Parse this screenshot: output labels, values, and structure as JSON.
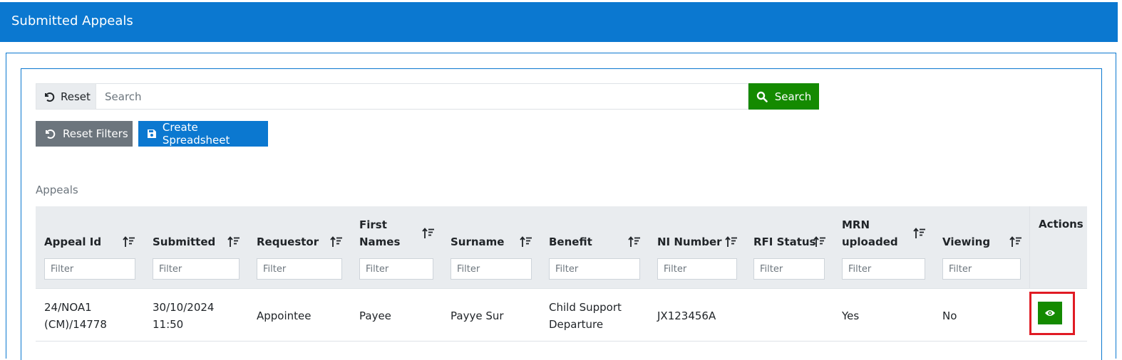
{
  "header": {
    "title": "Submitted Appeals"
  },
  "search": {
    "reset_label": "Reset",
    "placeholder": "Search",
    "value": "",
    "search_label": "Search"
  },
  "toolbar": {
    "reset_filters_label": "Reset Filters",
    "create_spreadsheet_label": "Create Spreadsheet"
  },
  "table": {
    "section_label": "Appeals",
    "filter_placeholder": "Filter",
    "columns": [
      {
        "line1": "Appeal Id",
        "line2": ""
      },
      {
        "line1": "Submitted",
        "line2": ""
      },
      {
        "line1": "Requestor",
        "line2": ""
      },
      {
        "line1": "First",
        "line2": "Names"
      },
      {
        "line1": "Surname",
        "line2": ""
      },
      {
        "line1": "Benefit",
        "line2": ""
      },
      {
        "line1": "NI Number",
        "line2": ""
      },
      {
        "line1": "RFI Status",
        "line2": ""
      },
      {
        "line1": "MRN",
        "line2": "uploaded"
      },
      {
        "line1": "Viewing",
        "line2": ""
      }
    ],
    "actions_label": "Actions",
    "rows": [
      {
        "appeal_id_1": "24/NOA1",
        "appeal_id_2": "(CM)/14778",
        "submitted_1": "30/10/2024",
        "submitted_2": "11:50",
        "requestor": "Appointee",
        "first_names": "Payee",
        "surname": "Payye Sur",
        "benefit_1": "Child Support",
        "benefit_2": "Departure",
        "ni_number": "JX123456A",
        "rfi_status": "",
        "mrn_uploaded": "Yes",
        "viewing": "No"
      }
    ]
  },
  "colors": {
    "primary": "#0b78d0",
    "success": "#148a00",
    "secondary": "#6c757d",
    "highlight": "#e01b24"
  },
  "icons": {
    "reset": "undo-icon",
    "search": "magnifier-icon",
    "save": "floppy-disk-icon",
    "sort": "sort-icon",
    "view": "eye-icon"
  }
}
